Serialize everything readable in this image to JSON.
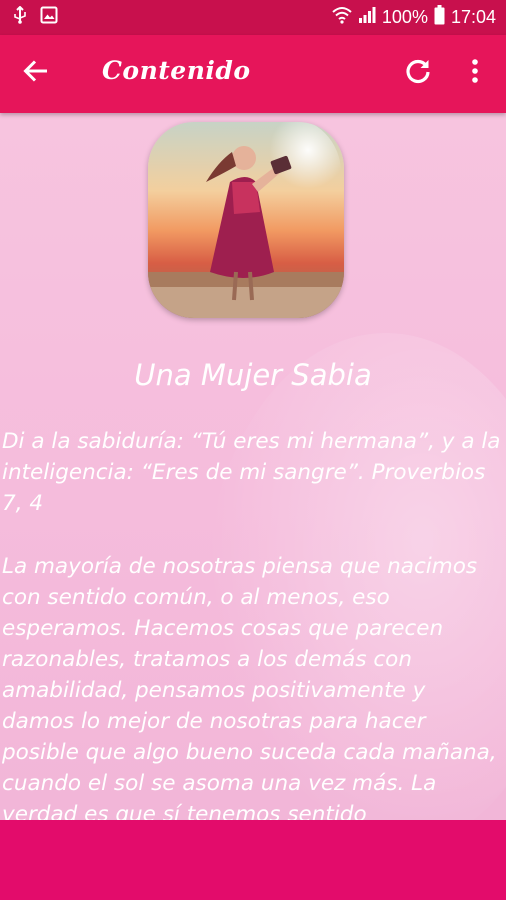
{
  "status_bar": {
    "battery": "100%",
    "time": "17:04",
    "icons": [
      "usb-icon",
      "image-icon",
      "wifi-icon",
      "signal-icon",
      "battery-icon"
    ]
  },
  "app_bar": {
    "title": "Contenido",
    "icons": [
      "back-arrow-icon",
      "refresh-icon",
      "more-vert-icon"
    ]
  },
  "article": {
    "title": "Una Mujer Sabia",
    "verse": "Di a la sabiduría: “Tú eres mi hermana”, y a la inteligencia: “Eres de mi sangre”. Proverbios 7, 4",
    "body": "La mayoría de nosotras piensa que nacimos con sentido común, o al menos, eso esperamos. Hacemos cosas que parecen razonables, tratamos a los demás con amabilidad, pensamos positivamente y damos lo mejor de nosotras para hacer posible que algo bueno suceda cada mañana, cuando el sol se asoma una vez más. La verdad es que sí tenemos sentido"
  },
  "colors": {
    "status_bar": "#c8104d",
    "app_bar": "#e6155a",
    "content_bg": "#f6bfdc",
    "bottom_bar": "#e30c6b",
    "text": "#ffffff"
  }
}
